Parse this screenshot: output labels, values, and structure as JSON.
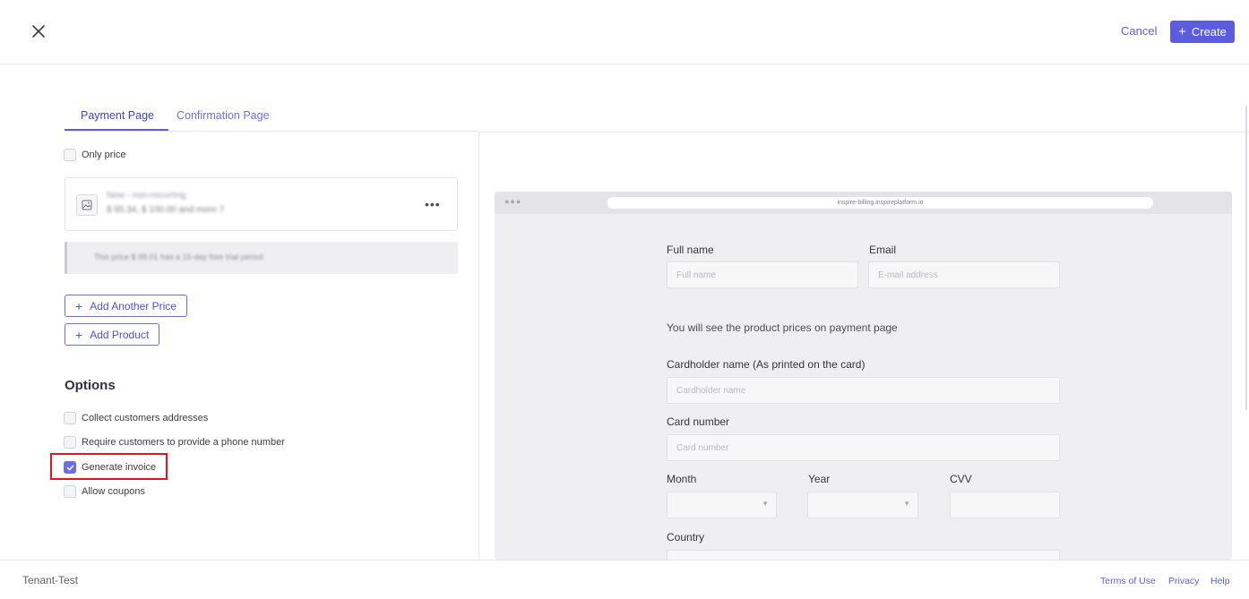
{
  "header": {
    "close_icon": "close-icon",
    "cancel_label": "Cancel",
    "create_label": "Create",
    "accent_color": "#5b5ce0"
  },
  "tabs": [
    {
      "label": "Payment Page",
      "active": true
    },
    {
      "label": "Confirmation Page",
      "active": false
    }
  ],
  "pricing": {
    "only_price_label": "Only price",
    "only_price_checked": false,
    "price_name": "New - non-recurring",
    "price_details": "$ 65.34, $ 100.00 and more 7",
    "trial_note": "This price $ 98.01 has a 15-day free trial period",
    "add_price_label": "Add Another Price",
    "add_product_label": "Add Product"
  },
  "options": {
    "title": "Options",
    "items": [
      {
        "label": "Collect customers addresses",
        "checked": false
      },
      {
        "label": "Require customers to provide a phone number",
        "checked": false
      },
      {
        "label": "Generate invoice",
        "checked": true
      },
      {
        "label": "Allow coupons",
        "checked": false
      }
    ]
  },
  "preview": {
    "url": "inspire-billing.inspireplatform.io",
    "full_name_label": "Full name",
    "full_name_placeholder": "Full name",
    "email_label": "Email",
    "email_placeholder": "E-mail address",
    "info_text": "You will see the product prices on payment page",
    "cardholder_label": "Cardholder name (As printed on the card)",
    "cardholder_placeholder": "Cardholder name",
    "card_number_label": "Card number",
    "card_number_placeholder": "Card number",
    "month_label": "Month",
    "year_label": "Year",
    "cvv_label": "CVV",
    "country_label": "Country"
  },
  "footer": {
    "tenant": "Tenant-Test",
    "terms": "Terms of Use",
    "privacy": "Privacy",
    "help": "Help"
  }
}
